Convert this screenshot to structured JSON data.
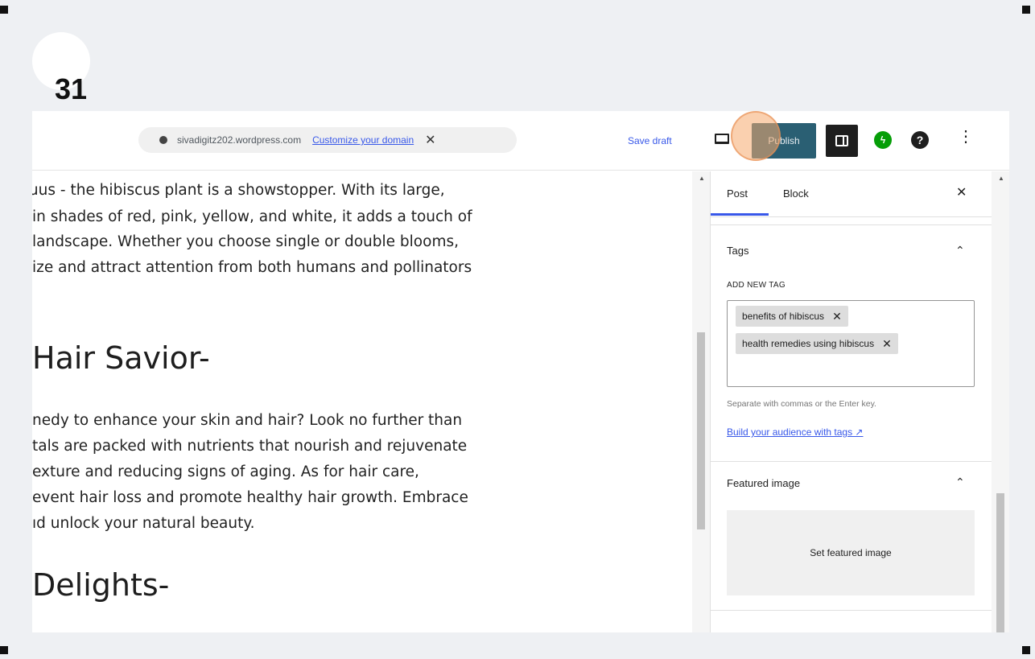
{
  "step": {
    "number": "31"
  },
  "topbar": {
    "site_url": "sivadigitz202.wordpress.com",
    "customize_label": "Customize your domain",
    "close_glyph": "✕",
    "save_draft_label": "Save draft",
    "publish_label": "Publish",
    "jetpack_glyph": "ϟ",
    "help_glyph": "?",
    "more_glyph": "⋮"
  },
  "content": {
    "paragraph1": [
      "ɹus - the hibiscus plant is a showstopper. With its large,",
      " in shades of red, pink, yellow, and white, it adds a touch of",
      " landscape. Whether you choose single or double blooms,",
      "ize and attract attention from both humans and pollinators"
    ],
    "heading1": " Hair Savior-",
    "paragraph2": [
      "nedy to enhance your skin and hair? Look no further than",
      "tals are packed with nutrients that nourish and rejuvenate",
      "exture and reducing signs of aging. As for hair care,",
      "event hair loss and promote healthy hair growth. Embrace",
      "ıd unlock your natural beauty."
    ],
    "heading2": "Delights-"
  },
  "sidebar": {
    "tabs": [
      {
        "label": "Post"
      },
      {
        "label": "Block"
      }
    ],
    "close_glyph": "✕",
    "tags": {
      "title": "Tags",
      "add_label": "ADD NEW TAG",
      "items": [
        {
          "label": "benefits of hibiscus",
          "remove": "✕"
        },
        {
          "label": "health remedies using hibiscus",
          "remove": "✕"
        }
      ],
      "hint": "Separate with commas or the Enter key.",
      "link": "Build your audience with tags ↗"
    },
    "featured": {
      "title": "Featured image",
      "button": "Set featured image"
    },
    "chevron_glyph": "⌃"
  },
  "colors": {
    "accent": "#3858e9",
    "publish_bg": "#2a5f73",
    "highlight": "#f5aa6e"
  }
}
